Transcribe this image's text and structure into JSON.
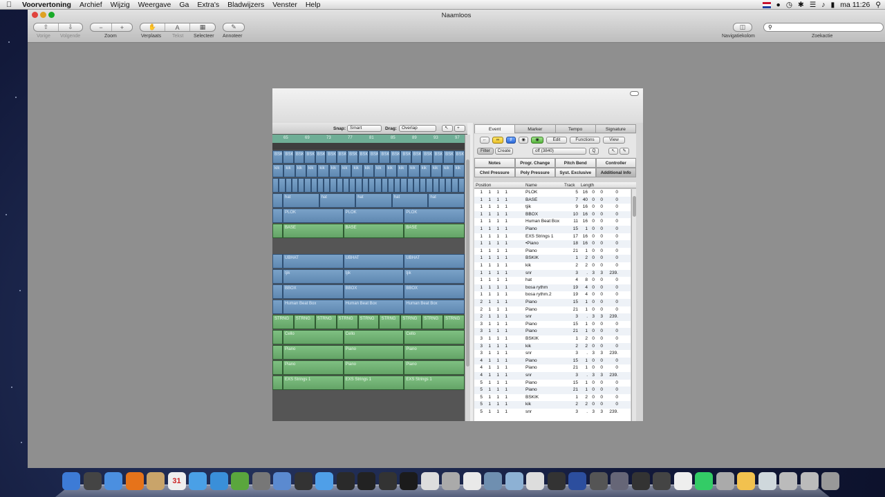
{
  "menubar": {
    "apple": "",
    "items": [
      "Voorvertoning",
      "Archief",
      "Wijzig",
      "Weergave",
      "Ga",
      "Extra's",
      "Bladwijzers",
      "Venster",
      "Help"
    ],
    "clock": "ma 11:26"
  },
  "window": {
    "title": "Naamloos",
    "toolbar": {
      "prev": "Vorige",
      "next": "Volgende",
      "zoom": "Zoom",
      "move": "Verplaats",
      "text": "Tekst",
      "select": "Selecteer",
      "annotate": "Annoteer",
      "nav": "Navigatiekolom",
      "search_label": "Zoekactie",
      "search_placeholder": "",
      "zoom_minus": "−",
      "zoom_plus": "+"
    }
  },
  "arrange": {
    "snap_label": "Snap:",
    "snap_value": "Smart",
    "drag_label": "Drag:",
    "drag_value": "Overlap",
    "ruler": [
      "65",
      "69",
      "73",
      "77",
      "81",
      "85",
      "89",
      "93",
      "97"
    ],
    "lanes": [
      {
        "kind": "bskik",
        "color": "blue",
        "label": "BSK",
        "count": 18
      },
      {
        "kind": "kik",
        "color": "blue",
        "label": "kik",
        "count": 17
      },
      {
        "kind": "snr",
        "color": "blue",
        "label": "",
        "count": 30
      },
      {
        "kind": "hat",
        "color": "blue",
        "label": "hat",
        "count": 5
      },
      {
        "kind": "plok",
        "color": "blue",
        "label": "PLOK",
        "count": 3
      },
      {
        "kind": "base",
        "color": "green",
        "label": "BASE",
        "count": 3
      },
      {
        "kind": "gap",
        "color": "dark",
        "label": "",
        "count": 0
      },
      {
        "kind": "ubhat",
        "color": "blue",
        "label": "UBHAT",
        "count": 3
      },
      {
        "kind": "tjik",
        "color": "blue",
        "label": "tjik",
        "count": 3
      },
      {
        "kind": "bbox",
        "color": "blue",
        "label": "BBOX",
        "count": 3
      },
      {
        "kind": "hbb",
        "color": "blue",
        "label": "Human Beat Box",
        "count": 3
      },
      {
        "kind": "strng",
        "color": "green",
        "label": "STRNG",
        "count": 9
      },
      {
        "kind": "cello",
        "color": "green",
        "label": "Cello",
        "count": 3
      },
      {
        "kind": "piano",
        "color": "green",
        "label": "Piano",
        "count": 3
      },
      {
        "kind": "piano2",
        "color": "green",
        "label": "Piano",
        "count": 3
      },
      {
        "kind": "exs",
        "color": "green",
        "label": "EXS Strings 1",
        "count": 3
      }
    ]
  },
  "eventlist": {
    "tabs": [
      "Event",
      "Marker",
      "Tempo",
      "Signature"
    ],
    "filter": "Filter",
    "create": "Create",
    "edit": "Edit",
    "functions": "Functions",
    "view": "View",
    "off_value": "off (3840)",
    "q": "Q",
    "filters": [
      "Notes",
      "Progr. Change",
      "Pitch Bend",
      "Controller",
      "Chnl Pressure",
      "Poly Pressure",
      "Syst. Exclusive",
      "Additional Info"
    ],
    "columns": {
      "position": "Position",
      "name": "Name",
      "track": "Track",
      "length": "Length"
    },
    "rows": [
      [
        "1",
        "1",
        "1",
        "1",
        "PLOK",
        "5",
        "16",
        "0",
        "0",
        "0"
      ],
      [
        "1",
        "1",
        "1",
        "1",
        "BASE",
        "7",
        "40",
        "0",
        "0",
        "0"
      ],
      [
        "1",
        "1",
        "1",
        "1",
        "tjik",
        "9",
        "16",
        "0",
        "0",
        "0"
      ],
      [
        "1",
        "1",
        "1",
        "1",
        "BBOX",
        "10",
        "16",
        "0",
        "0",
        "0"
      ],
      [
        "1",
        "1",
        "1",
        "1",
        "Human Beat Box",
        "11",
        "16",
        "0",
        "0",
        "0"
      ],
      [
        "1",
        "1",
        "1",
        "1",
        "Piano",
        "15",
        "1",
        "0",
        "0",
        "0"
      ],
      [
        "1",
        "1",
        "1",
        "1",
        "EXS Strings 1",
        "17",
        "16",
        "0",
        "0",
        "0"
      ],
      [
        "1",
        "1",
        "1",
        "1",
        "•Piano",
        "18",
        "16",
        "0",
        "0",
        "0"
      ],
      [
        "1",
        "1",
        "1",
        "1",
        "Piano",
        "21",
        "1",
        "0",
        "0",
        "0"
      ],
      [
        "1",
        "1",
        "1",
        "1",
        "BSKIK",
        "1",
        "2",
        "0",
        "0",
        "0"
      ],
      [
        "1",
        "1",
        "1",
        "1",
        "kik",
        "2",
        "2",
        "0",
        "0",
        "0"
      ],
      [
        "1",
        "1",
        "1",
        "1",
        "snr",
        "3",
        ".",
        "3",
        "3",
        "239."
      ],
      [
        "1",
        "1",
        "1",
        "1",
        "hat",
        "4",
        "8",
        "0",
        "0",
        "0"
      ],
      [
        "1",
        "1",
        "1",
        "1",
        "bosa rythm",
        "19",
        "4",
        "0",
        "0",
        "0"
      ],
      [
        "1",
        "1",
        "1",
        "1",
        "bosa rythm.2",
        "19",
        "4",
        "0",
        "0",
        "0"
      ],
      [
        "2",
        "1",
        "1",
        "1",
        "Piano",
        "15",
        "1",
        "0",
        "0",
        "0"
      ],
      [
        "2",
        "1",
        "1",
        "1",
        "Piano",
        "21",
        "1",
        "0",
        "0",
        "0"
      ],
      [
        "2",
        "1",
        "1",
        "1",
        "snr",
        "3",
        ".",
        "3",
        "3",
        "239."
      ],
      [
        "3",
        "1",
        "1",
        "1",
        "Piano",
        "15",
        "1",
        "0",
        "0",
        "0"
      ],
      [
        "3",
        "1",
        "1",
        "1",
        "Piano",
        "21",
        "1",
        "0",
        "0",
        "0"
      ],
      [
        "3",
        "1",
        "1",
        "1",
        "BSKIK",
        "1",
        "2",
        "0",
        "0",
        "0"
      ],
      [
        "3",
        "1",
        "1",
        "1",
        "kik",
        "2",
        "2",
        "0",
        "0",
        "0"
      ],
      [
        "3",
        "1",
        "1",
        "1",
        "snr",
        "3",
        ".",
        "3",
        "3",
        "239."
      ],
      [
        "4",
        "1",
        "1",
        "1",
        "Piano",
        "15",
        "1",
        "0",
        "0",
        "0"
      ],
      [
        "4",
        "1",
        "1",
        "1",
        "Piano",
        "21",
        "1",
        "0",
        "0",
        "0"
      ],
      [
        "4",
        "1",
        "1",
        "1",
        "snr",
        "3",
        ".",
        "3",
        "3",
        "239."
      ],
      [
        "5",
        "1",
        "1",
        "1",
        "Piano",
        "15",
        "1",
        "0",
        "0",
        "0"
      ],
      [
        "5",
        "1",
        "1",
        "1",
        "Piano",
        "21",
        "1",
        "0",
        "0",
        "0"
      ],
      [
        "5",
        "1",
        "1",
        "1",
        "BSKIK",
        "1",
        "2",
        "0",
        "0",
        "0"
      ],
      [
        "5",
        "1",
        "1",
        "1",
        "kik",
        "2",
        "2",
        "0",
        "0",
        "0"
      ],
      [
        "5",
        "1",
        "1",
        "1",
        "snr",
        "3",
        ".",
        "3",
        "3",
        "239."
      ]
    ]
  },
  "dock": {
    "icons": [
      "finder-icon",
      "dashboard-icon",
      "safari-icon",
      "firefox-icon",
      "preview-icon",
      "ical-icon",
      "itunes-icon",
      "iweb-icon",
      "garageband-icon",
      "image-capture-icon",
      "iphoto-icon",
      "autopilot-icon",
      "app-store-icon",
      "imovie-icon",
      "terminal-icon",
      "logic-icon",
      "quicktime-icon",
      "utility-icon",
      "tool-icon",
      "notes-icon",
      "photo-icon",
      "folder-icon",
      "download-icon",
      "waveform-icon",
      "waveform2-icon",
      "keyboard-icon",
      "person-icon",
      "camera-icon",
      "camera2-icon",
      "drums-icon",
      "pen-icon",
      "drive-icon",
      "package-icon",
      "browser-icon",
      "screen-icon",
      "screen2-icon",
      "trash-icon"
    ],
    "ical_day": "31"
  }
}
